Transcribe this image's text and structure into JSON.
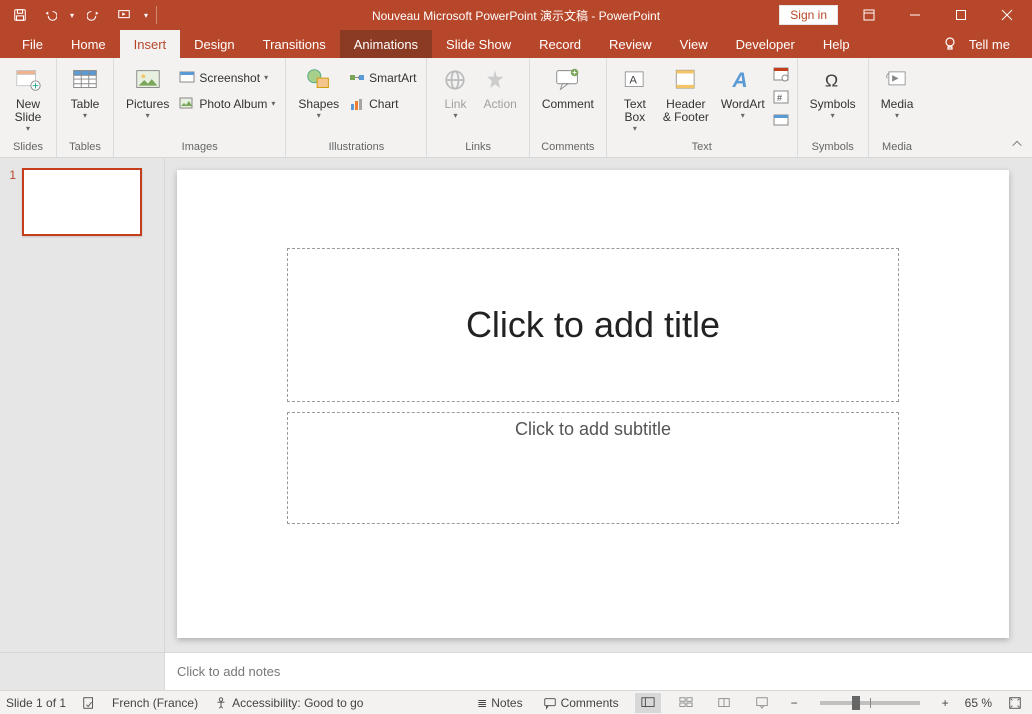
{
  "title": "Nouveau Microsoft PowerPoint 演示文稿  -  PowerPoint",
  "signin": "Sign in",
  "tabs": {
    "file": "File",
    "home": "Home",
    "insert": "Insert",
    "design": "Design",
    "transitions": "Transitions",
    "animations": "Animations",
    "slideshow": "Slide Show",
    "record": "Record",
    "review": "Review",
    "view": "View",
    "developer": "Developer",
    "help": "Help",
    "tellme": "Tell me"
  },
  "ribbon": {
    "groups": {
      "slides": "Slides",
      "tables": "Tables",
      "images": "Images",
      "illustrations": "Illustrations",
      "links": "Links",
      "comments": "Comments",
      "text": "Text",
      "symbols": "Symbols",
      "media": "Media"
    },
    "newslide": "New\nSlide",
    "table": "Table",
    "pictures": "Pictures",
    "screenshot": "Screenshot",
    "photoalbum": "Photo Album",
    "shapes": "Shapes",
    "smartart": "SmartArt",
    "chart": "Chart",
    "link": "Link",
    "action": "Action",
    "comment": "Comment",
    "textbox": "Text\nBox",
    "headerfooter": "Header\n& Footer",
    "wordart": "WordArt",
    "symbolsbtn": "Symbols",
    "media": "Media"
  },
  "slide": {
    "num": "1",
    "title_ph": "Click to add title",
    "subtitle_ph": "Click to add subtitle"
  },
  "notes_ph": "Click to add notes",
  "status": {
    "slidecount": "Slide 1 of 1",
    "language": "French (France)",
    "accessibility": "Accessibility: Good to go",
    "notes": "Notes",
    "comments": "Comments",
    "zoom": "65 %"
  }
}
